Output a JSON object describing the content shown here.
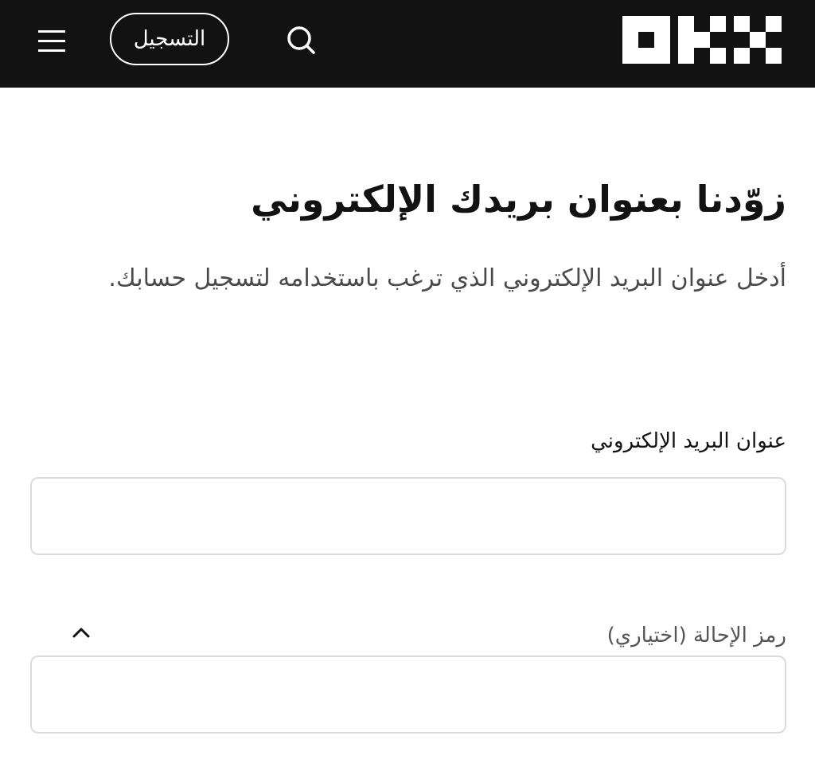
{
  "header": {
    "menu_icon": "hamburger-menu-icon",
    "signup_label": "التسجيل",
    "search_icon": "search-icon",
    "logo_icon": "okx-logo-icon"
  },
  "form": {
    "title": "زوّدنا بعنوان بريدك الإلكتروني",
    "subtitle": "أدخل عنوان البريد الإلكتروني الذي ترغب باستخدامه لتسجيل حسابك.",
    "email_label": "عنوان البريد الإلكتروني",
    "email_value": "",
    "referral_label": "رمز الإحالة (اختياري)",
    "referral_value": "",
    "referral_toggle_icon": "chevron-up-icon"
  },
  "colors": {
    "header_bg": "#121212",
    "header_fg": "#ffffff",
    "input_border": "#dcdcdc"
  }
}
